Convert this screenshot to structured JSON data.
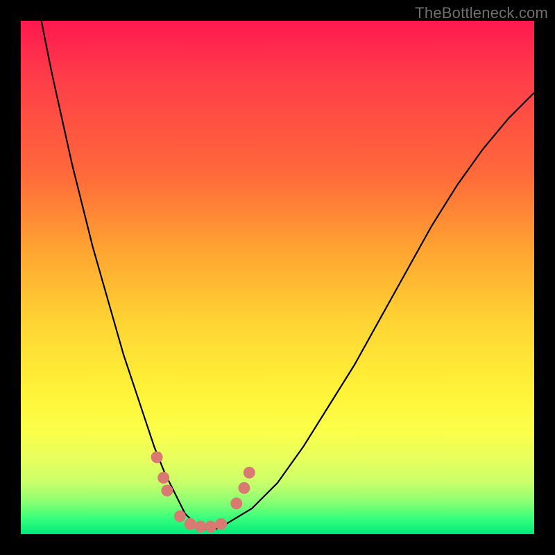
{
  "watermark": "TheBottleneck.com",
  "chart_data": {
    "type": "line",
    "title": "",
    "xlabel": "",
    "ylabel": "",
    "xlim": [
      0,
      100
    ],
    "ylim": [
      0,
      100
    ],
    "background_gradient": {
      "top": "#ff1850",
      "upper_mid": "#ffa531",
      "mid": "#fff338",
      "lower_mid": "#c9ff6a",
      "bottom": "#00e97a"
    },
    "series": [
      {
        "name": "bottleneck-curve",
        "color": "#000000",
        "x": [
          4,
          6,
          8,
          10,
          12,
          14,
          16,
          18,
          20,
          22,
          24,
          26,
          28,
          30,
          32,
          34,
          36,
          38,
          40,
          45,
          50,
          55,
          60,
          65,
          70,
          75,
          80,
          85,
          90,
          95,
          100
        ],
        "values": [
          100,
          90,
          81,
          72,
          64,
          56,
          49,
          42,
          35,
          29,
          23,
          17,
          12,
          8,
          4,
          2,
          1,
          1,
          2,
          5,
          10,
          17,
          25,
          33,
          42,
          51,
          60,
          68,
          75,
          81,
          86
        ]
      }
    ],
    "markers": [
      {
        "name": "dot",
        "x": 26.5,
        "y": 15,
        "color": "#d97a72"
      },
      {
        "name": "dot",
        "x": 27.8,
        "y": 11,
        "color": "#d97a72"
      },
      {
        "name": "dot",
        "x": 28.5,
        "y": 8.5,
        "color": "#d97a72"
      },
      {
        "name": "dot",
        "x": 31.0,
        "y": 3.5,
        "color": "#d97a72"
      },
      {
        "name": "dot",
        "x": 33.0,
        "y": 2.0,
        "color": "#d97a72"
      },
      {
        "name": "dot",
        "x": 35.0,
        "y": 1.5,
        "color": "#d97a72"
      },
      {
        "name": "dot",
        "x": 37.0,
        "y": 1.5,
        "color": "#d97a72"
      },
      {
        "name": "dot",
        "x": 39.0,
        "y": 2.0,
        "color": "#d97a72"
      },
      {
        "name": "dot",
        "x": 42.0,
        "y": 6.0,
        "color": "#d97a72"
      },
      {
        "name": "dot",
        "x": 43.5,
        "y": 9.0,
        "color": "#d97a72"
      },
      {
        "name": "dot",
        "x": 44.5,
        "y": 12.0,
        "color": "#d97a72"
      }
    ]
  }
}
